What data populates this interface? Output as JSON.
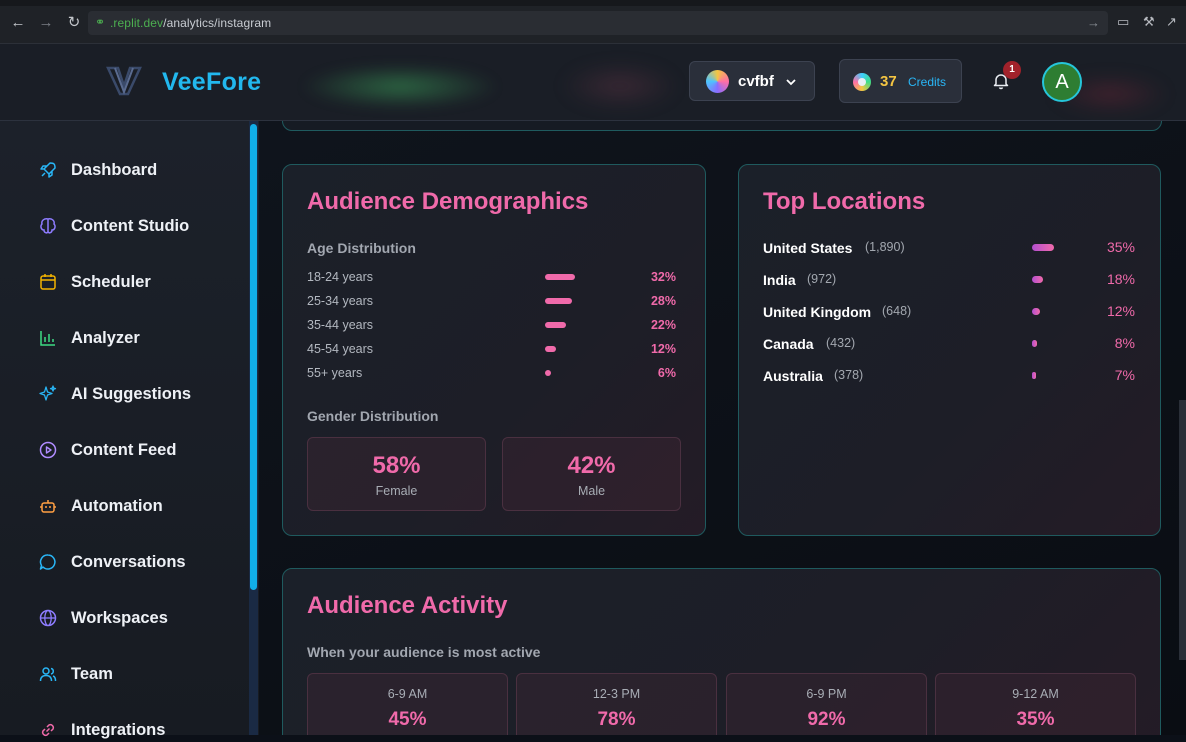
{
  "browser": {
    "url_domain": ".replit.dev",
    "url_path": "/analytics/instagram"
  },
  "header": {
    "brand": "VeeFore",
    "workspace": "cvfbf",
    "credits_value": "37",
    "credits_label": "Credits",
    "notification_count": "1",
    "avatar_initial": "A"
  },
  "sidebar": {
    "items": [
      {
        "label": "Dashboard",
        "icon": "rocket-icon",
        "color": "#29b6f6"
      },
      {
        "label": "Content Studio",
        "icon": "brain-icon",
        "color": "#8e7cff"
      },
      {
        "label": "Scheduler",
        "icon": "calendar-icon",
        "color": "#f4b400"
      },
      {
        "label": "Analyzer",
        "icon": "bar-chart-icon",
        "color": "#3ddc84"
      },
      {
        "label": "AI Suggestions",
        "icon": "sparkles-icon",
        "color": "#29b6f6"
      },
      {
        "label": "Content Feed",
        "icon": "play-circle-icon",
        "color": "#b08cff"
      },
      {
        "label": "Automation",
        "icon": "bot-icon",
        "color": "#ff9f43"
      },
      {
        "label": "Conversations",
        "icon": "chat-bubble-icon",
        "color": "#29b6f6"
      },
      {
        "label": "Workspaces",
        "icon": "globe-icon",
        "color": "#8e7cff"
      },
      {
        "label": "Team",
        "icon": "users-icon",
        "color": "#29b6f6"
      },
      {
        "label": "Integrations",
        "icon": "link-icon",
        "color": "#f06aaa"
      }
    ]
  },
  "demographics": {
    "title": "Audience Demographics",
    "age_title": "Age Distribution",
    "age_rows": [
      {
        "label": "18-24 years",
        "pct": "32%",
        "value": 32
      },
      {
        "label": "25-34 years",
        "pct": "28%",
        "value": 28
      },
      {
        "label": "35-44 years",
        "pct": "22%",
        "value": 22
      },
      {
        "label": "45-54 years",
        "pct": "12%",
        "value": 12
      },
      {
        "label": "55+ years",
        "pct": "6%",
        "value": 6
      }
    ],
    "gender_title": "Gender Distribution",
    "female_value": "58%",
    "female_label": "Female",
    "male_value": "42%",
    "male_label": "Male"
  },
  "locations": {
    "title": "Top Locations",
    "rows": [
      {
        "name": "United States",
        "count": "(1,890)",
        "pct": "35%",
        "value": 35
      },
      {
        "name": "India",
        "count": "(972)",
        "pct": "18%",
        "value": 18
      },
      {
        "name": "United Kingdom",
        "count": "(648)",
        "pct": "12%",
        "value": 12
      },
      {
        "name": "Canada",
        "count": "(432)",
        "pct": "8%",
        "value": 8
      },
      {
        "name": "Australia",
        "count": "(378)",
        "pct": "7%",
        "value": 7
      }
    ]
  },
  "activity": {
    "title": "Audience Activity",
    "subtitle": "When your audience is most active",
    "slots": [
      {
        "time": "6-9 AM",
        "value": "45%"
      },
      {
        "time": "12-3 PM",
        "value": "78%"
      },
      {
        "time": "6-9 PM",
        "value": "92%"
      },
      {
        "time": "9-12 AM",
        "value": "35%"
      }
    ]
  }
}
